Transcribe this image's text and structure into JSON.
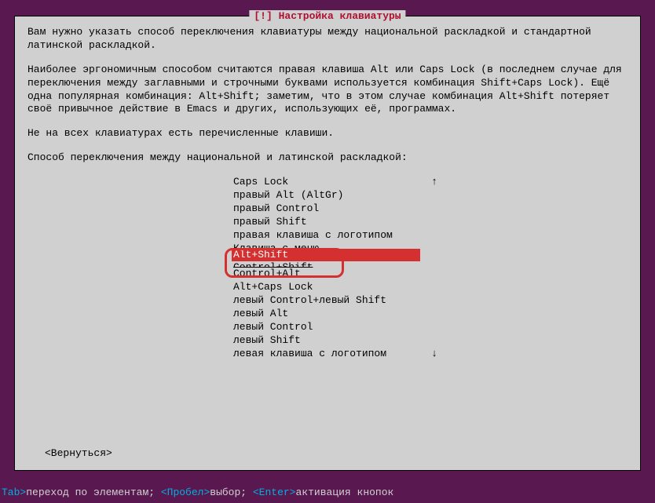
{
  "dialog": {
    "title": "[!] Настройка клавиатуры",
    "para1": "Вам нужно указать способ переключения клавиатуры между национальной раскладкой и стандартной латинской раскладкой.",
    "para2": "Наиболее эргономичным способом считаются правая клавиша Alt или Caps Lock (в последнем случае для переключения между заглавными и строчными буквами используется комбинация Shift+Caps Lock). Ещё одна популярная комбинация: Alt+Shift; заметим, что в этом случае комбинация Alt+Shift потеряет своё привычное действие в Emacs и других, использующих её, программах.",
    "para3": "Не на всех клавиатурах есть перечисленные клавиши.",
    "prompt": "Способ переключения между национальной и латинской раскладкой:",
    "options": [
      "Caps Lock",
      "правый Alt (AltGr)",
      "правый Control",
      "правый Shift",
      "правая клавиша с логотипом",
      "Клавиша с меню",
      "Alt+Shift",
      "Control+Shift",
      "Control+Alt",
      "Alt+Caps Lock",
      "левый Control+левый Shift",
      "левый Alt",
      "левый Control",
      "левый Shift",
      "левая клавиша с логотипом"
    ],
    "selected_index": 6,
    "back_label": "<Вернуться>",
    "scroll_up": "↑",
    "scroll_down": "↓"
  },
  "help": {
    "tab": "Tab>",
    "tab_text": "переход по элементам;",
    "space": " <Пробел>",
    "space_text": "выбор;",
    "enter": " <Enter>",
    "enter_text": "активация кнопок"
  }
}
